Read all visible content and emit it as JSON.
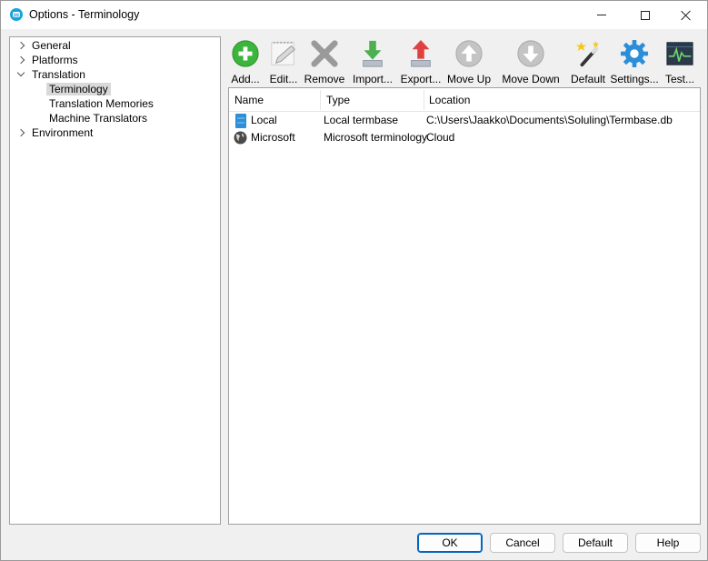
{
  "window": {
    "title": "Options - Terminology"
  },
  "tree": {
    "items": [
      {
        "label": "General",
        "expanded": false,
        "level": 0
      },
      {
        "label": "Platforms",
        "expanded": false,
        "level": 0
      },
      {
        "label": "Translation",
        "expanded": true,
        "level": 0
      },
      {
        "label": "Terminology",
        "selected": true,
        "level": 1
      },
      {
        "label": "Translation Memories",
        "level": 1
      },
      {
        "label": "Machine Translators",
        "level": 1
      },
      {
        "label": "Environment",
        "expanded": false,
        "level": 0
      }
    ]
  },
  "toolbar": {
    "add": "Add...",
    "edit": "Edit...",
    "remove": "Remove",
    "import": "Import...",
    "export": "Export...",
    "move_up": "Move Up",
    "move_down": "Move Down",
    "default": "Default",
    "settings": "Settings...",
    "test": "Test..."
  },
  "list": {
    "columns": [
      "Name",
      "Type",
      "Location"
    ],
    "rows": [
      {
        "name": "Local",
        "type": "Local termbase",
        "location": "C:\\Users\\Jaakko\\Documents\\Soluling\\Termbase.db",
        "icon": "database-icon"
      },
      {
        "name": "Microsoft",
        "type": "Microsoft terminology",
        "location": "Cloud",
        "icon": "globe-icon"
      }
    ]
  },
  "buttons": {
    "ok": "OK",
    "cancel": "Cancel",
    "default": "Default",
    "help": "Help"
  },
  "colors": {
    "accent": "#0067c0",
    "add_green": "#3cb53c",
    "export_red": "#e04040",
    "import_green": "#4caf50",
    "settings_blue": "#2a8fd8"
  }
}
